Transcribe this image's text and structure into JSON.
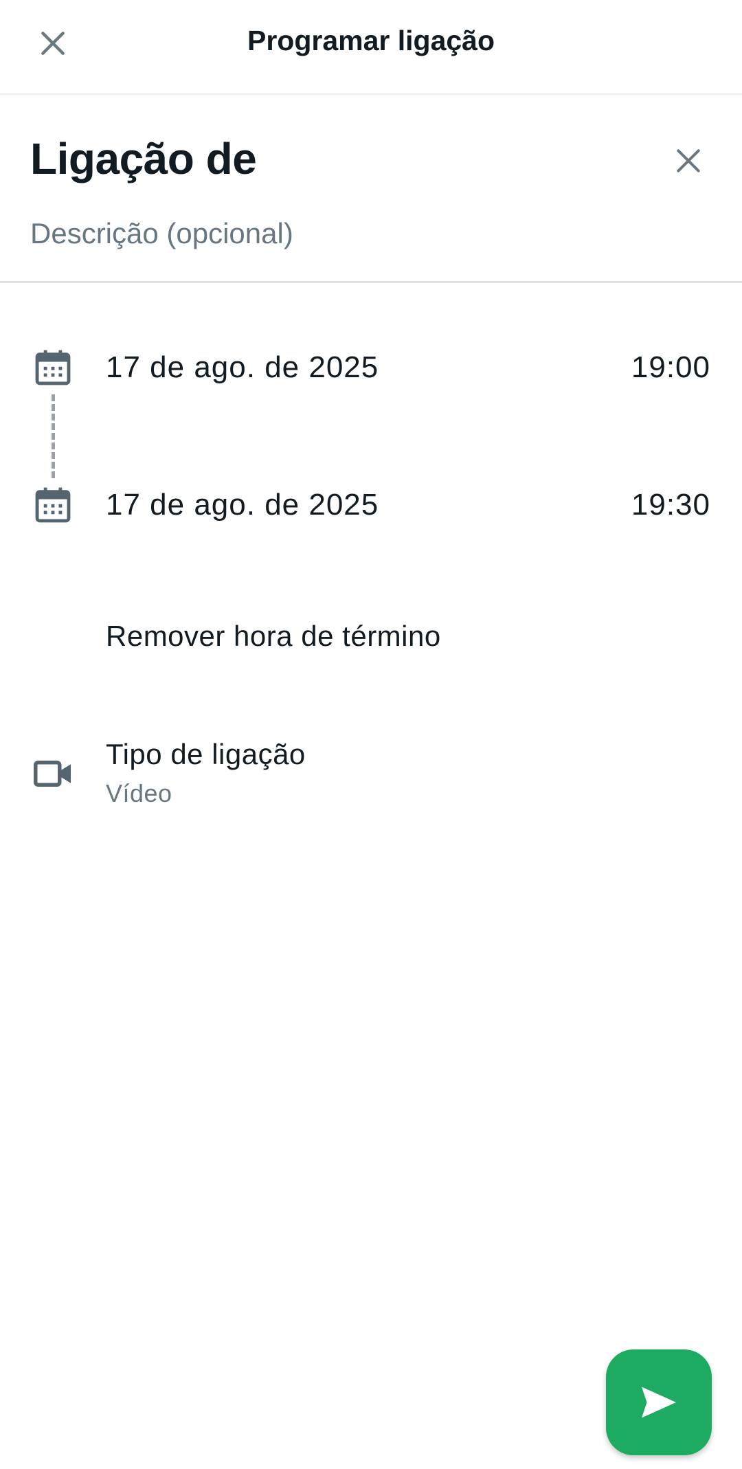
{
  "topbar": {
    "title": "Programar ligação"
  },
  "header": {
    "call_name": "Ligação de",
    "description_placeholder": "Descrição (opcional)"
  },
  "start": {
    "date": "17 de ago. de 2025",
    "time": "19:00"
  },
  "end": {
    "date": "17 de ago. de 2025",
    "time": "19:30"
  },
  "remove_end_label": "Remover hora de término",
  "call_type": {
    "label": "Tipo de ligação",
    "value": "Vídeo"
  },
  "icons": {
    "close": "close-icon",
    "clear": "clear-icon",
    "calendar": "calendar-icon",
    "video": "video-camera-icon",
    "send": "send-icon"
  },
  "colors": {
    "accent": "#1daa61",
    "icon_gray": "#54656f",
    "secondary_text": "#667781"
  }
}
